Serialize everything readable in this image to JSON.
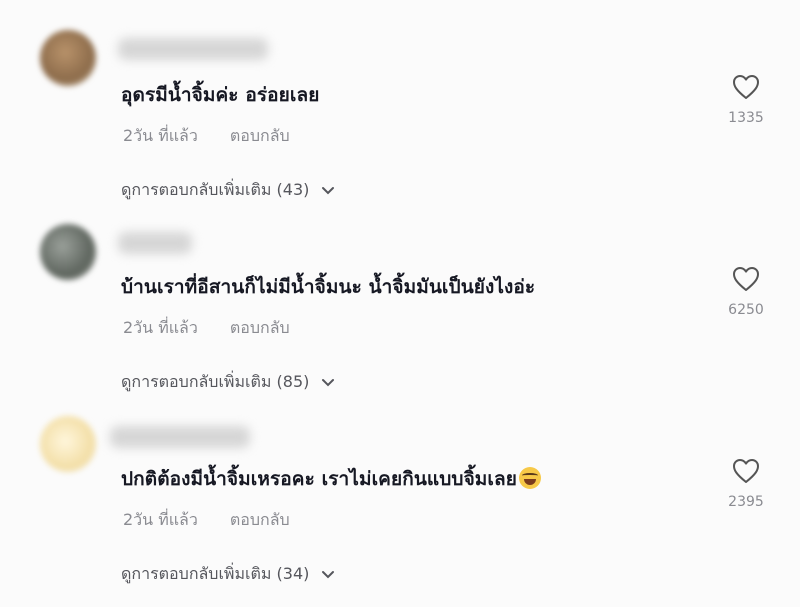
{
  "comments": [
    {
      "text": "อุดรมีน้ำจิ้มค่ะ อร่อยเลย",
      "time": "2วัน ที่แล้ว",
      "reply": "ตอบกลับ",
      "more_replies": "ดูการตอบกลับเพิ่มเติม (43)",
      "likes": "1335"
    },
    {
      "text": "บ้านเราที่อีสานก็ไม่มีน้ำจิ้มนะ น้ำจิ้มมันเป็นยังไงอ่ะ",
      "time": "2วัน ที่แล้ว",
      "reply": "ตอบกลับ",
      "more_replies": "ดูการตอบกลับเพิ่มเติม (85)",
      "likes": "6250"
    },
    {
      "text": "ปกติต้องมีน้ำจิ้มเหรอคะ เราไม่เคยกินแบบจิ้มเลย",
      "time": "2วัน ที่แล้ว",
      "reply": "ตอบกลับ",
      "more_replies": "ดูการตอบกลับเพิ่มเติม (34)",
      "likes": "2395",
      "emoji": "laughing-tears-emoji"
    }
  ],
  "icons": {
    "like": "heart-icon",
    "expand": "chevron-down-icon"
  }
}
